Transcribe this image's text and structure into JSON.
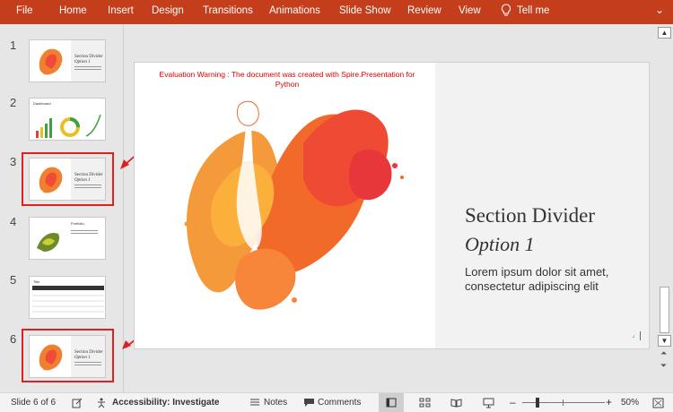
{
  "ribbon": {
    "tabs": [
      "File",
      "Home",
      "Insert",
      "Design",
      "Transitions",
      "Animations",
      "Slide Show",
      "Review",
      "View"
    ],
    "tell_me": "Tell me",
    "color": "#c43e1c"
  },
  "thumbnails": [
    {
      "number": "1",
      "title": "Section Divider",
      "subtitle": "Option 1"
    },
    {
      "number": "2",
      "title": "Dashboard"
    },
    {
      "number": "3",
      "title": "Section Divider",
      "subtitle": "Option 1"
    },
    {
      "number": "4",
      "title": "Portfolio"
    },
    {
      "number": "5",
      "title": "Title"
    },
    {
      "number": "6",
      "title": "Section Divider",
      "subtitle": "Option 1"
    }
  ],
  "slide": {
    "warning": "Evaluation Warning : The document was created with  Spire.Presentation for Python",
    "title": "Section Divider",
    "subtitle": "Option 1",
    "body": "Lorem ipsum dolor sit amet, consectetur adipiscing elit"
  },
  "status": {
    "slide_info": "Slide 6 of 6",
    "accessibility": "Accessibility: Investigate",
    "notes": "Notes",
    "comments": "Comments",
    "zoom": "50%",
    "minus": "–",
    "plus": "+"
  },
  "accent_red": "#e02020"
}
